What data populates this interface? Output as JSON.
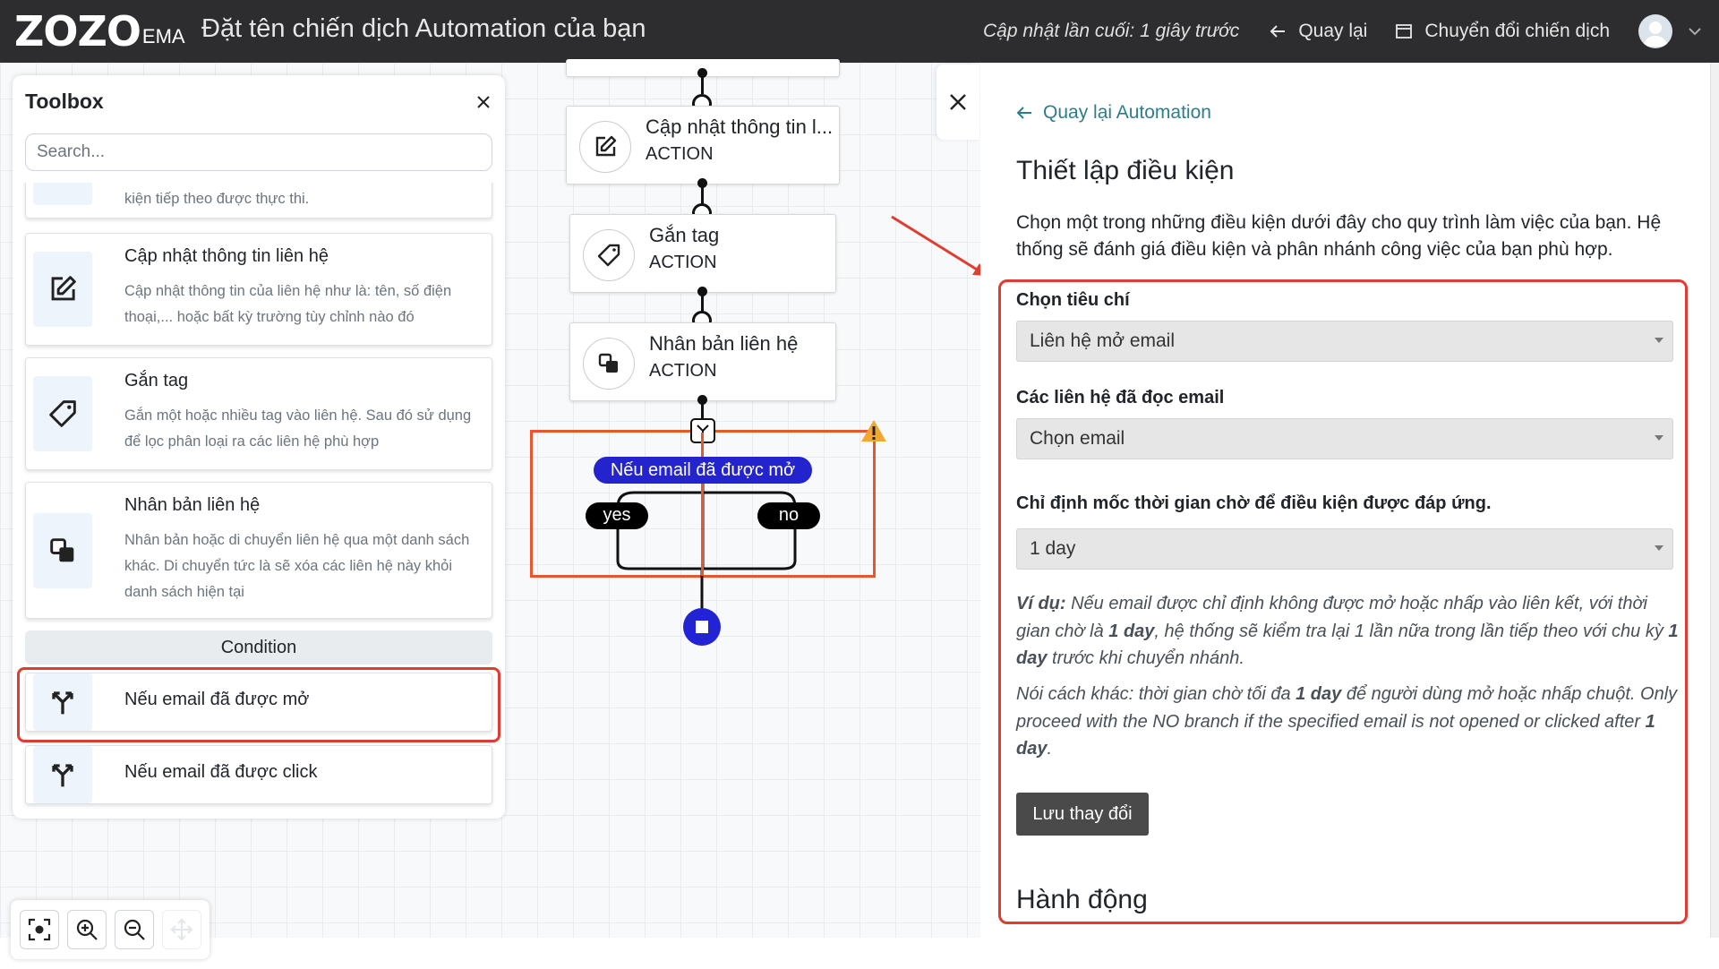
{
  "header": {
    "logo_text": "ZOZO",
    "logo_sub": "EMA",
    "title": "Đặt tên chiến dịch Automation của bạn",
    "last_update": "Cập nhật lần cuối: 1 giây trước",
    "back_label": "Quay lại",
    "switch_label": "Chuyển đổi chiến dịch"
  },
  "toolbox": {
    "title": "Toolbox",
    "search_placeholder": "Search...",
    "partial_item_desc": "kiện tiếp theo được thực thi.",
    "items": [
      {
        "title": "Cập nhật thông tin liên hệ",
        "desc": "Cập nhật thông tin của liên hệ như là: tên, số điện thoại,... hoặc bất kỳ trường tùy chỉnh nào đó",
        "icon": "edit-icon"
      },
      {
        "title": "Gắn tag",
        "desc": "Gắn một hoặc nhiều tag vào liên hệ. Sau đó sử dụng để lọc phân loại ra các liên hệ phù hợp",
        "icon": "tag-icon"
      },
      {
        "title": "Nhân bản liên hệ",
        "desc": "Nhân bản hoặc di chuyển liên hệ qua một danh sách khác. Di chuyển tức là sẽ xóa các liên hệ này khỏi danh sách hiện tại",
        "icon": "copy-icon"
      }
    ],
    "section_condition": "Condition",
    "conditions": [
      {
        "title": "Nếu email đã được mở",
        "icon": "split-icon"
      },
      {
        "title": "Nếu email đã được click",
        "icon": "split-icon"
      }
    ]
  },
  "flow": {
    "nodes": [
      {
        "title": "Cập nhật thông tin l...",
        "sub": "ACTION",
        "icon": "edit-icon"
      },
      {
        "title": "Gắn tag",
        "sub": "ACTION",
        "icon": "tag-icon"
      },
      {
        "title": "Nhân bản liên hệ",
        "sub": "ACTION",
        "icon": "copy-icon"
      }
    ],
    "condition_label": "Nếu email đã được mở",
    "yes_label": "yes",
    "no_label": "no"
  },
  "panel": {
    "back_link": "Quay lại Automation",
    "heading": "Thiết lập điều kiện",
    "description": "Chọn một trong những điều kiện dưới đây cho quy trình làm việc của bạn. Hệ thống sẽ đánh giá điều kiện và phân nhánh công việc của bạn phù hợp.",
    "criteria_label": "Chọn tiêu chí",
    "criteria_value": "Liên hệ mở email",
    "email_label": "Các liên hệ đã đọc email",
    "email_value": "Chọn email",
    "wait_label": "Chỉ định mốc thời gian chờ để điều kiện được đáp ứng.",
    "wait_value": "1 day",
    "example1_prefix": "Ví dụ:",
    "example1_a": " Nếu email được chỉ định không được mở hoặc nhấp vào liên kết, với thời gian chờ là ",
    "example1_b": "1 day",
    "example1_c": ", hệ thống sẽ kiểm tra lại 1 lần nữa trong lần tiếp theo với chu kỳ ",
    "example1_d": "1 day",
    "example1_e": " trước khi chuyển nhánh.",
    "example2_a": "Nói cách khác: thời gian chờ tối đa ",
    "example2_b": "1 day",
    "example2_c": " để người dùng mở hoặc nhấp chuột. Only proceed with the NO branch if the specified email is not opened or clicked after ",
    "example2_d": "1 day",
    "example2_e": ".",
    "save_label": "Lưu thay đổi",
    "actions_heading": "Hành động"
  },
  "colors": {
    "topbar": "#2d2d2f",
    "accent_blue": "#2424ce",
    "highlight_red": "#e03c31",
    "link_teal": "#2f7d8c"
  }
}
